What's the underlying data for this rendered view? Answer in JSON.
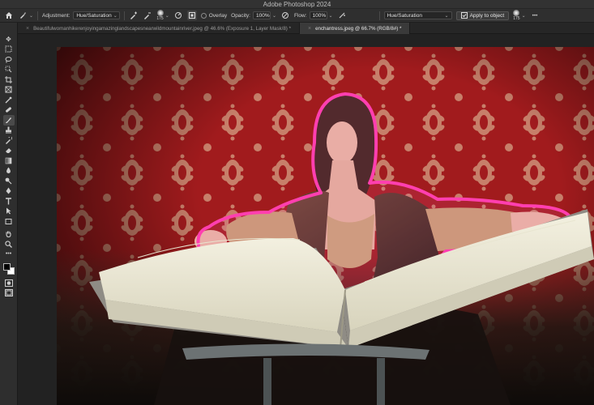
{
  "app": {
    "title": "Adobe Photoshop 2024"
  },
  "options_bar": {
    "adjustment_label": "Adjustment:",
    "adjustment_value": "Hue/Saturation",
    "brush_size_left": "175",
    "overlay_label": "Overlay",
    "opacity_label": "Opacity:",
    "opacity_value": "100%",
    "flow_label": "Flow:",
    "flow_value": "100%",
    "right_adjustment_value": "Hue/Saturation",
    "apply_button": "Apply to object",
    "brush_size_right": "175",
    "more": "•••"
  },
  "tabs": [
    {
      "label": "Beautifulwomanhikerenjoyingamazinglandscapesnearwildmountainriver.jpeg @ 46.6% (Exposure 1, Layer Mask/8) *",
      "close": "×"
    },
    {
      "label": "enchantress.jpeg @ 66.7% (RGB/8#) *",
      "close": "×"
    }
  ],
  "toolbar": {
    "tools": [
      "move",
      "marquee",
      "lasso",
      "object-select",
      "crop",
      "frame",
      "eyedropper",
      "healing",
      "brush",
      "clone-stamp",
      "history-brush",
      "eraser",
      "gradient",
      "blur",
      "dodge",
      "pen",
      "type",
      "path-select",
      "shape",
      "hand",
      "zoom",
      "more"
    ]
  },
  "colors": {
    "accent_outline": "#ff3fb0",
    "wallpaper_red": "#a31c1e",
    "damask_gold": "#d7a98a"
  }
}
